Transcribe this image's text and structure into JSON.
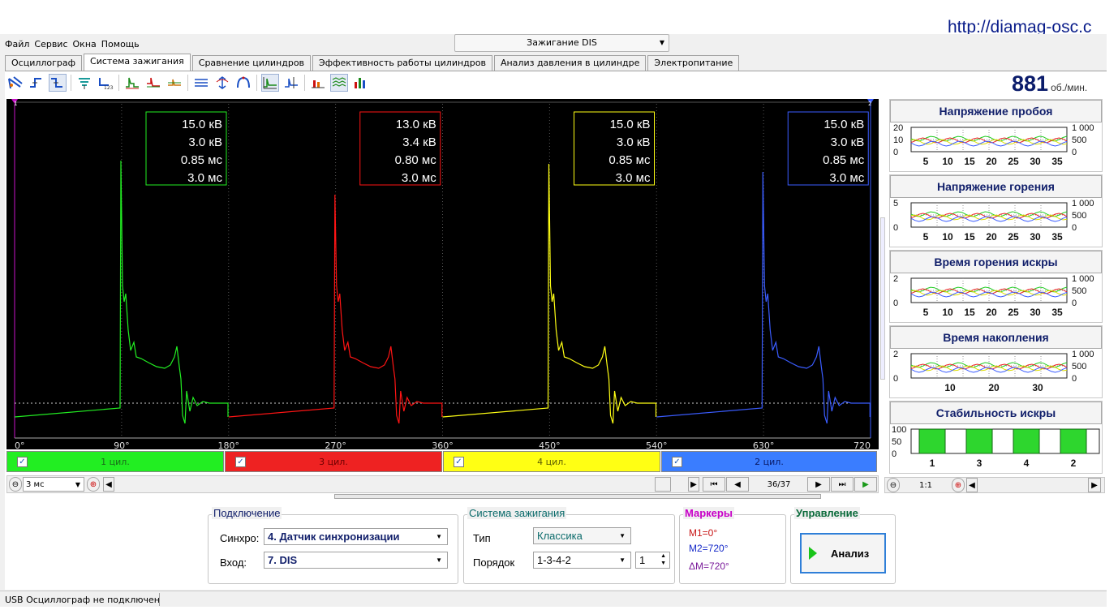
{
  "url_banner": "http://diamag-osc.c",
  "menu": [
    "Файл",
    "Сервис",
    "Окна",
    "Помощь"
  ],
  "mode_select": "Зажигание DIS",
  "tabs": [
    "Осциллограф",
    "Система зажигания",
    "Сравнение цилиндров",
    "Эффективность работы цилиндров",
    "Анализ давления в цилиндре",
    "Электропитание"
  ],
  "active_tab": 1,
  "rpm": {
    "value": "881",
    "unit": "об./мин."
  },
  "toolbar_icons": [
    "cursor-icon",
    "rising-trigger-icon",
    "falling-trigger-icon",
    "probe-icon",
    "counter-icon",
    "waveform-overlay-icon",
    "waveform-sync-icon",
    "waveform-offset-icon",
    "lines-icon",
    "scale-icon",
    "arc-icon",
    "grid-icon",
    "marker-icon",
    "bar-chart-icon",
    "stripes-icon",
    "histogram-icon"
  ],
  "scope": {
    "x_ticks": [
      "0°",
      "90°",
      "180°",
      "270°",
      "360°",
      "450°",
      "540°",
      "630°",
      "720"
    ],
    "cylinders": [
      {
        "color": "#22ee22",
        "lines": [
          "15.0 кВ",
          "3.0 кВ",
          "0.85 мс",
          "3.0 мс"
        ]
      },
      {
        "color": "#ff1414",
        "lines": [
          "13.0 кВ",
          "3.4 кВ",
          "0.80 мс",
          "3.0 мс"
        ]
      },
      {
        "color": "#ffff14",
        "lines": [
          "15.0 кВ",
          "3.0 кВ",
          "0.85 мс",
          "3.0 мс"
        ]
      },
      {
        "color": "#3a5cff",
        "lines": [
          "15.0 кВ",
          "3.0 кВ",
          "0.85 мс",
          "3.0 мс"
        ]
      }
    ],
    "marker_left": "1",
    "marker_right": "2"
  },
  "channels": [
    {
      "label": "1 цил.",
      "bg": "#22ee22",
      "text": "#1a6b1a"
    },
    {
      "label": "3 цил.",
      "bg": "#ee2222",
      "text": "#6b0000"
    },
    {
      "label": "4 цил.",
      "bg": "#ffff14",
      "text": "#5a5a00"
    },
    {
      "label": "2 цил.",
      "bg": "#3a7dff",
      "text": "#0a1a66"
    }
  ],
  "nav": {
    "time_select": "3 мс",
    "frame": "36/37",
    "zoom": "1:1"
  },
  "params": [
    {
      "title": "Напряжение пробоя",
      "left_ticks": [
        "20",
        "10",
        "0"
      ],
      "right_ticks": [
        "1 000",
        "500",
        "0"
      ],
      "x_ticks": [
        "5",
        "10",
        "15",
        "20",
        "25",
        "30",
        "35"
      ]
    },
    {
      "title": "Напряжение горения",
      "left_ticks": [
        "5",
        "0"
      ],
      "right_ticks": [
        "1 000",
        "500",
        "0"
      ],
      "x_ticks": [
        "5",
        "10",
        "15",
        "20",
        "25",
        "30",
        "35"
      ]
    },
    {
      "title": "Время горения искры",
      "left_ticks": [
        "2",
        "0"
      ],
      "right_ticks": [
        "1 000",
        "500",
        "0"
      ],
      "x_ticks": [
        "5",
        "10",
        "15",
        "20",
        "25",
        "30",
        "35"
      ]
    },
    {
      "title": "Время накопления",
      "left_ticks": [
        "2",
        "0"
      ],
      "right_ticks": [
        "1 000",
        "500",
        "0"
      ],
      "x_ticks": [
        "10",
        "20",
        "30"
      ]
    }
  ],
  "stability": {
    "title": "Стабильность искры",
    "left_ticks": [
      "100",
      "50",
      "0"
    ],
    "cylinders": [
      "1",
      "3",
      "4",
      "2"
    ],
    "values": [
      100,
      100,
      100,
      100
    ]
  },
  "connection": {
    "title": "Подключение",
    "sync_label": "Синхро:",
    "sync_value": "4.  Датчик синхронизации",
    "input_label": "Вход:",
    "input_value": "7.  DIS"
  },
  "ignition": {
    "title": "Система зажигания",
    "type_label": "Тип",
    "type_value": "Классика",
    "order_label": "Порядок",
    "order_value": "1-3-4-2",
    "order_num": "1"
  },
  "markers": {
    "title": "Маркеры",
    "m1": "М1=0°",
    "m2": "М2=720°",
    "dm": "ΔМ=720°"
  },
  "control": {
    "title": "Управление",
    "button": "Анализ"
  },
  "status": "USB Осциллограф не подключен"
}
